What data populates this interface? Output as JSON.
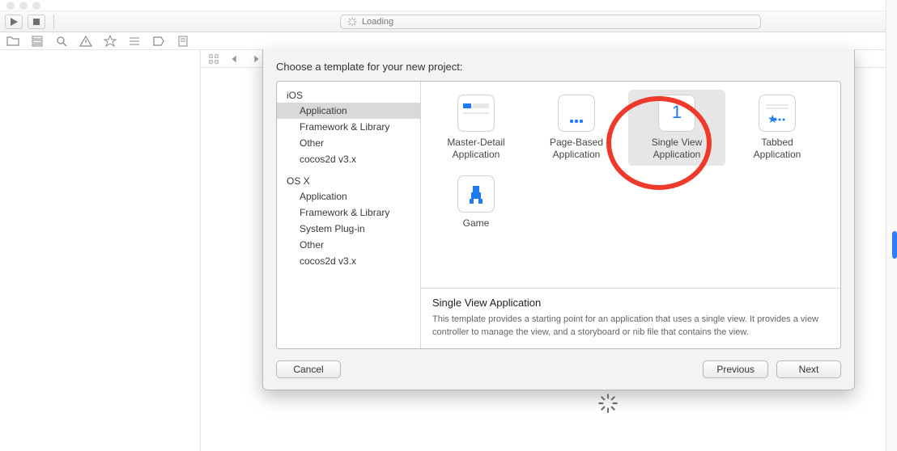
{
  "toolbar": {
    "loading_label": "Loading"
  },
  "sheet": {
    "title": "Choose a template for your new project:",
    "categories": [
      {
        "header": "iOS",
        "items": [
          {
            "label": "Application",
            "selected": true
          },
          {
            "label": "Framework & Library",
            "selected": false
          },
          {
            "label": "Other",
            "selected": false
          },
          {
            "label": "cocos2d v3.x",
            "selected": false
          }
        ]
      },
      {
        "header": "OS X",
        "items": [
          {
            "label": "Application",
            "selected": false
          },
          {
            "label": "Framework & Library",
            "selected": false
          },
          {
            "label": "System Plug-in",
            "selected": false
          },
          {
            "label": "Other",
            "selected": false
          },
          {
            "label": "cocos2d v3.x",
            "selected": false
          }
        ]
      }
    ],
    "templates": [
      {
        "id": "master-detail",
        "label": "Master-Detail\nApplication",
        "selected": false
      },
      {
        "id": "page-based",
        "label": "Page-Based\nApplication",
        "selected": false
      },
      {
        "id": "single-view",
        "label": "Single View\nApplication",
        "selected": true
      },
      {
        "id": "tabbed",
        "label": "Tabbed\nApplication",
        "selected": false
      },
      {
        "id": "game",
        "label": "Game",
        "selected": false
      }
    ],
    "description": {
      "title": "Single View Application",
      "text": "This template provides a starting point for an application that uses a single view. It provides a view controller to manage the view, and a storyboard or nib file that contains the view."
    },
    "buttons": {
      "cancel": "Cancel",
      "previous": "Previous",
      "next": "Next"
    }
  }
}
